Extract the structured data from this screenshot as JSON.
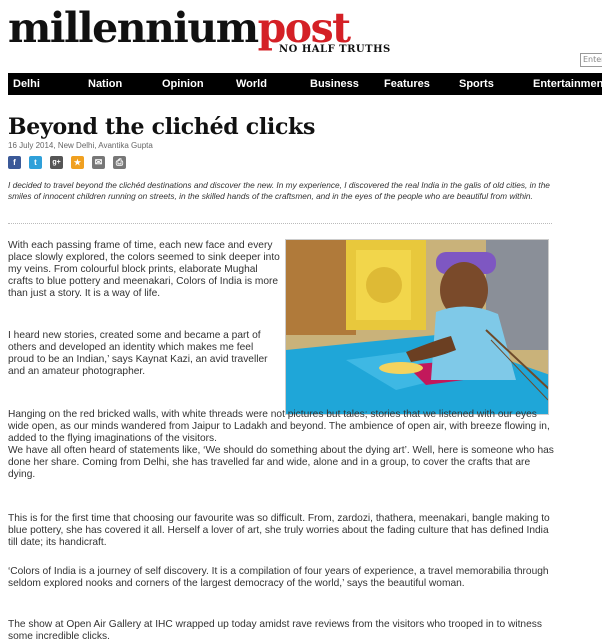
{
  "site": {
    "logo_part1": "millennium",
    "logo_part2": "post",
    "tagline": "NO HALF TRUTHS",
    "search_placeholder": "Enter"
  },
  "nav": [
    "Delhi",
    "Nation",
    "Opinion",
    "World",
    "Business",
    "Features",
    "Sports",
    "Entertainment"
  ],
  "article": {
    "title": "Beyond the clichéd clicks",
    "byline": "16 July 2014, New Delhi, Avantika Gupta",
    "intro": "I decided to travel beyond the clichéd destinations and discover the new. In my experience, I discovered the real India in the galis of old cities, in the smiles of innocent children running on streets, in the skilled hands of the craftsmen, and in the eyes of the people who are beautiful from within.",
    "image_alt": "Craftsman doing zardozi embroidery on a blue fabric",
    "paragraphs": [
      "With each passing frame of time, each new face and every place slowly explored, the colors seemed to sink deeper into my veins.  From colourful block prints, elaborate Mughal crafts to blue pottery and meenakari, Colors of India is more than just a story. It is a way of life.",
      "I heard new stories, created some and became a part of others and developed an identity which makes me feel proud to be an Indian,’ says Kaynat Kazi, an avid traveller and an amateur photographer.",
      "Hanging on the red bricked walls, with white threads were not pictures but tales; stories that we listened with our eyes wide open, as our minds wandered from Jaipur to Ladakh and beyond. The ambience of open air, with breeze flowing in, added to the flying imaginations of the visitors.\nWe have all often heard of statements like, ‘We should do something about the dying art’. Well, here is someone who has done her share. Coming from Delhi, she has travelled far and wide, alone and in a group, to cover the crafts that are dying.",
      "This is for the first time that choosing our favourite was so difficult. From, zardozi, thathera, meenakari, bangle making to blue pottery, she has covered it all. Herself a lover of art, she truly worries about the fading culture that has defined India till date; its handicraft.",
      "‘Colors of India is a journey of self discovery. It is a compilation of four years of experience, a  travel memorabilia  through seldom explored nooks and corners of the largest democracy of the world,’ says the beautiful woman.",
      "The show at Open Air Gallery at IHC wrapped up today amidst rave reviews from the visitors who trooped in to witness some incredible clicks."
    ]
  },
  "share_buttons": [
    {
      "name": "facebook-icon",
      "glyph": "f",
      "color": "#3b5998"
    },
    {
      "name": "twitter-icon",
      "glyph": "t",
      "color": "#2fa0d9"
    },
    {
      "name": "google-plus-icon",
      "glyph": "g+",
      "color": "#555555"
    },
    {
      "name": "star-icon",
      "glyph": "★",
      "color": "#f0a020"
    },
    {
      "name": "email-icon",
      "glyph": "✉",
      "color": "#777777"
    },
    {
      "name": "print-icon",
      "glyph": "⎙",
      "color": "#777777"
    }
  ],
  "colors": {
    "brand_red": "#d42026",
    "nav_bg": "#000000"
  }
}
